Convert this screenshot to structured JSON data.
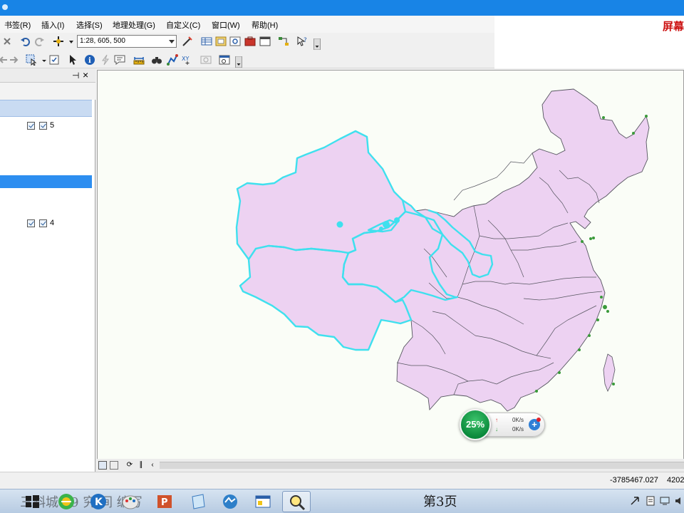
{
  "menu": {
    "items": [
      "书签(R)",
      "插入(I)",
      "选择(S)",
      "地理处理(G)",
      "自定义(C)",
      "窗口(W)",
      "帮助(H)"
    ]
  },
  "toolbar": {
    "scale_value": "1:28, 605, 500"
  },
  "overlay": {
    "screen_label": "屏幕"
  },
  "toc": {
    "pin_glyph": "⊣",
    "close_glyph": "×",
    "layers": [
      {
        "value": "5"
      },
      {
        "value": "4"
      }
    ]
  },
  "network_widget": {
    "percent": "25%",
    "upload": "0K/s",
    "download": "0K/s"
  },
  "status": {
    "coord_x": "-3785467.027",
    "coord_y": "4202"
  },
  "taskbar": {
    "text_overlay": "三斜城  39 究  间  编写",
    "page_label": "第3页"
  },
  "colors": {
    "titlebar": "#1884e6",
    "map_fill": "#edd2f2",
    "map_border": "#55555f",
    "selection": "#3fe0ee",
    "toc_highlight": "#2d8ef0"
  },
  "icons": {
    "toolbar1": [
      "close-icon",
      "undo-icon",
      "redo-icon",
      "add-data-icon",
      "dropdown-arrow-icon",
      "editor-icon",
      "table-icon",
      "catalog-icon",
      "search-window-icon",
      "arctoolbox-icon",
      "python-icon",
      "model-builder-icon",
      "whats-this-icon"
    ],
    "toolbar2": [
      "back-icon",
      "forward-icon",
      "select-features-icon",
      "clear-selection-icon",
      "select-elements-icon",
      "identify-icon",
      "hyperlink-icon",
      "html-popup-icon",
      "measure-icon",
      "find-icon",
      "find-route-icon",
      "go-to-xy-icon",
      "time-slider-icon",
      "create-viewer-icon"
    ]
  }
}
